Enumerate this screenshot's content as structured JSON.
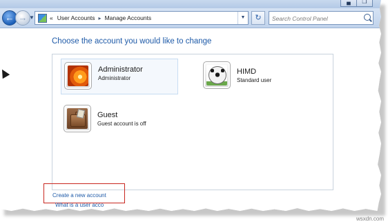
{
  "window": {
    "caption": {
      "minimize_icon": "minimize-icon",
      "maximize_icon": "maximize-icon"
    }
  },
  "navbar": {
    "back_icon": "back-arrow-icon",
    "forward_icon": "forward-arrow-icon",
    "overflow_chevron": "«",
    "breadcrumb": [
      "User Accounts",
      "Manage Accounts"
    ],
    "breadcrumb_separator": "▸",
    "refresh_icon": "refresh-icon",
    "search": {
      "placeholder": "Search Control Panel"
    }
  },
  "main": {
    "title": "Choose the account you would like to change",
    "accounts": [
      {
        "name": "Administrator",
        "type": "Administrator",
        "picture": "flower",
        "selected": true
      },
      {
        "name": "HIMD",
        "type": "Standard user",
        "picture": "soccer-ball",
        "selected": false
      },
      {
        "name": "Guest",
        "type": "Guest account is off",
        "picture": "briefcase",
        "selected": false
      }
    ],
    "links": {
      "create_account": "Create a new account",
      "what_is": "What is a user acco"
    }
  },
  "watermark": "wsxdn.com",
  "colors": {
    "link": "#1e5aa8",
    "highlight_border": "#c8261e",
    "title": "#1e5aa8"
  }
}
